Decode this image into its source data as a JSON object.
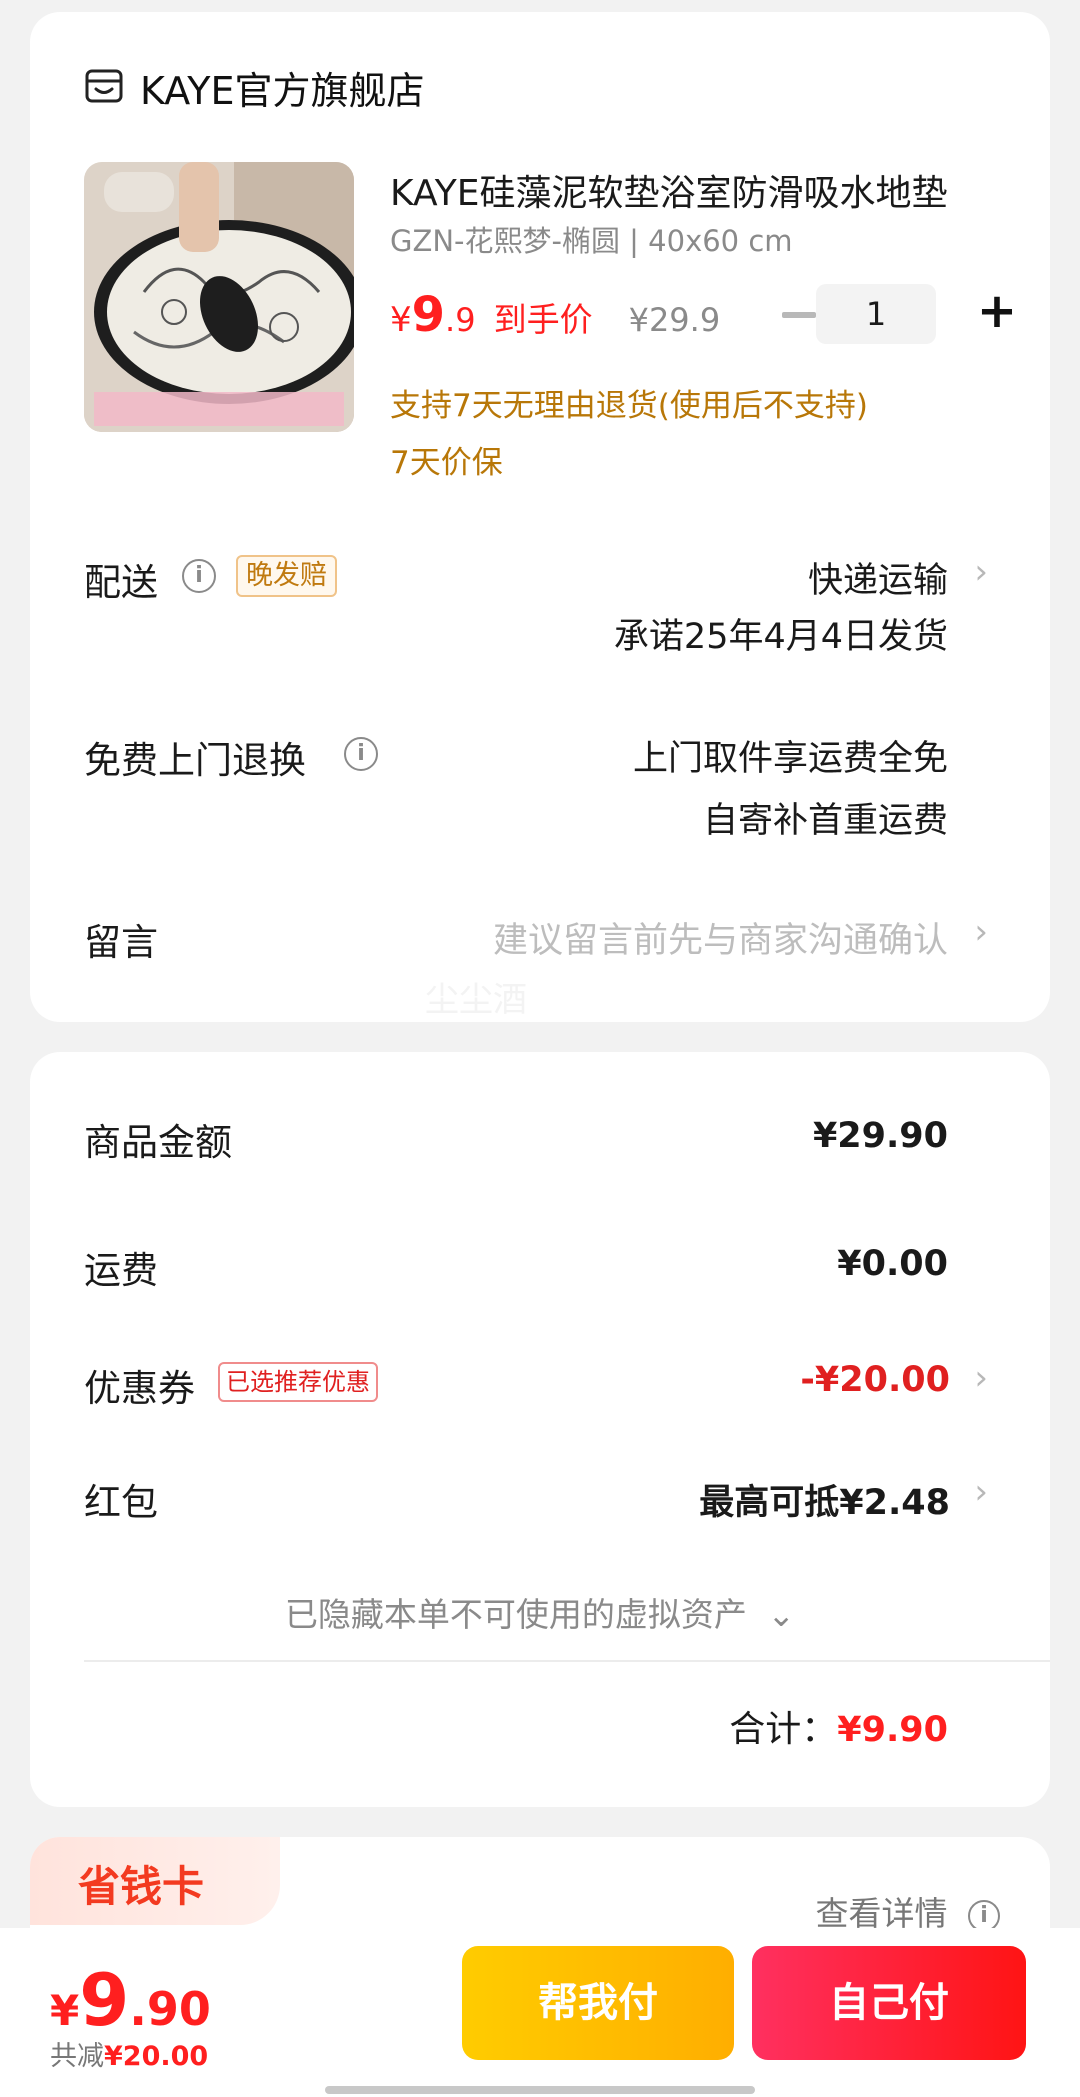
{
  "store": {
    "name": "KAYE官方旗舰店",
    "icon": "store-icon"
  },
  "product": {
    "title": "KAYE硅藻泥软垫浴室防滑吸水地垫",
    "spec": "GZN-花熙梦-椭圆 | 40x60 cm",
    "price_symbol": "¥",
    "price_int": "9",
    "price_dec": ".9",
    "price_tag": "到手价",
    "original_price": "¥29.9",
    "quantity": "1",
    "services": [
      "支持7天无理由退货(使用后不支持)",
      "7天价保"
    ]
  },
  "shipping": {
    "label": "配送",
    "badge": "晚发赔",
    "method": "快递运输",
    "promise": "承诺25年4月4日发货"
  },
  "return_service": {
    "label": "免费上门退换",
    "line1": "上门取件享运费全免",
    "line2": "自寄补首重运费"
  },
  "message": {
    "label": "留言",
    "placeholder": "建议留言前先与商家沟通确认",
    "watermark": "尘尘酒"
  },
  "summary": {
    "goods_label": "商品金额",
    "goods_value": "¥29.90",
    "freight_label": "运费",
    "freight_value": "¥0.00",
    "coupon_label": "优惠券",
    "coupon_badge": "已选推荐优惠",
    "coupon_value": "-¥20.00",
    "redpacket_label": "红包",
    "redpacket_value": "最高可抵¥2.48",
    "hidden_assets": "已隐藏本单不可使用的虚拟资产",
    "total_label": "合计：",
    "total_value": "¥9.90"
  },
  "save_card": {
    "title": "省钱卡",
    "details": "查看详情"
  },
  "bottom": {
    "price_symbol": "¥",
    "price_int": "9",
    "price_dec": ".90",
    "saved_label": "共减",
    "saved_value": "¥20.00",
    "help_pay": "帮我付",
    "self_pay": "自己付"
  },
  "colors": {
    "accent_red": "#ff1f1f",
    "service_gold": "#b87708",
    "help_button": "#ffb800",
    "self_button": "#ff1f3a"
  }
}
